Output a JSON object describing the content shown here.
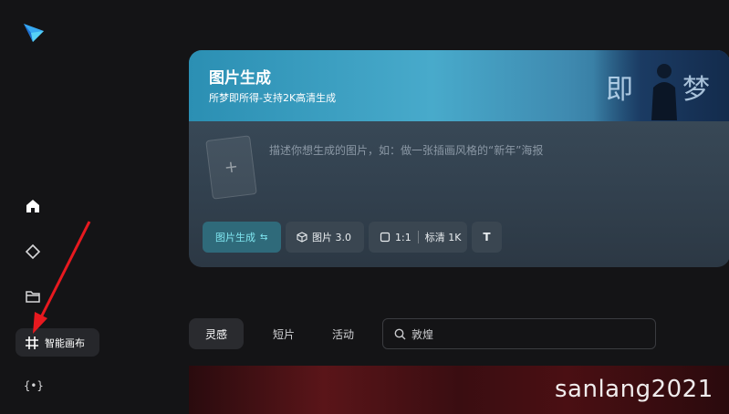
{
  "sidebar": {
    "canvas_label": "智能画布",
    "code_icon_text": "{•}"
  },
  "card": {
    "title": "图片生成",
    "subtitle": "所梦即所得-支持2K高清生成",
    "banner_chars": [
      "即",
      "梦"
    ],
    "upload_plus": "+",
    "prompt_placeholder": "描述你想生成的图片，如：做一张插画风格的“新年”海报",
    "toolbar": {
      "mode_label": "图片生成",
      "mode_icon": "⇆",
      "model_label": "图片 3.0",
      "ratio_label": "1:1",
      "quality_label": "标清 1K",
      "text_icon": "T"
    }
  },
  "tabs": [
    {
      "label": "灵感",
      "active": true
    },
    {
      "label": "短片",
      "active": false
    },
    {
      "label": "活动",
      "active": false
    }
  ],
  "search": {
    "value": "敦煌"
  },
  "watermark": "sanlang2021",
  "colors": {
    "background": "#141416",
    "accent": "#7fe6f0",
    "annotation_arrow": "#e8191f"
  }
}
